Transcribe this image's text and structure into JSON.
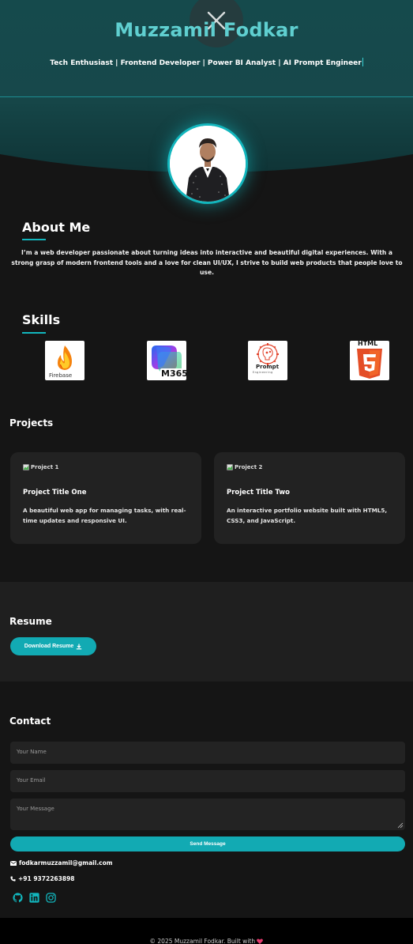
{
  "header": {
    "title": "Muzzamil Fodkar",
    "tagline": "Tech Enthusiast | Frontend Developer | Power BI Analyst | AI Prompt Engineer"
  },
  "about": {
    "heading": "About Me",
    "text": "I’m a web developer passionate about turning ideas into interactive and beautiful digital experiences. With a strong grasp of modern frontend tools and a love for clean UI/UX, I strive to build web products that people love to use."
  },
  "skills": {
    "heading": "Skills",
    "items": [
      {
        "icon": "firebase-icon",
        "label": "Firebase"
      },
      {
        "icon": "m365-icon",
        "label": "M365"
      },
      {
        "icon": "prompt-engineering-icon",
        "label": "Prompt",
        "sublabel": "Engineering"
      },
      {
        "icon": "html5-icon",
        "label": "HTML",
        "badge": "5"
      }
    ]
  },
  "projects": {
    "heading": "Projects",
    "items": [
      {
        "image_alt": "Project 1",
        "title": "Project Title One",
        "description": "A beautiful web app for managing tasks, with real-time updates and responsive UI."
      },
      {
        "image_alt": "Project 2",
        "title": "Project Title Two",
        "description": "An interactive portfolio website built with HTML5, CSS3, and JavaScript."
      }
    ]
  },
  "resume": {
    "heading": "Resume",
    "button_label": "Download Resume"
  },
  "contact": {
    "heading": "Contact",
    "name_placeholder": "Your Name",
    "email_placeholder": "Your Email",
    "message_placeholder": "Your Message",
    "send_label": "Send Message",
    "email": "fodkarmuzzamil@gmail.com",
    "phone": "+91 9372263898"
  },
  "footer": {
    "text": "© 2025 Muzzamil Fodkar. Built with"
  },
  "colors": {
    "accent": "#12b6bd",
    "title": "#5fcfd0",
    "background": "#151515",
    "card": "#222222"
  }
}
